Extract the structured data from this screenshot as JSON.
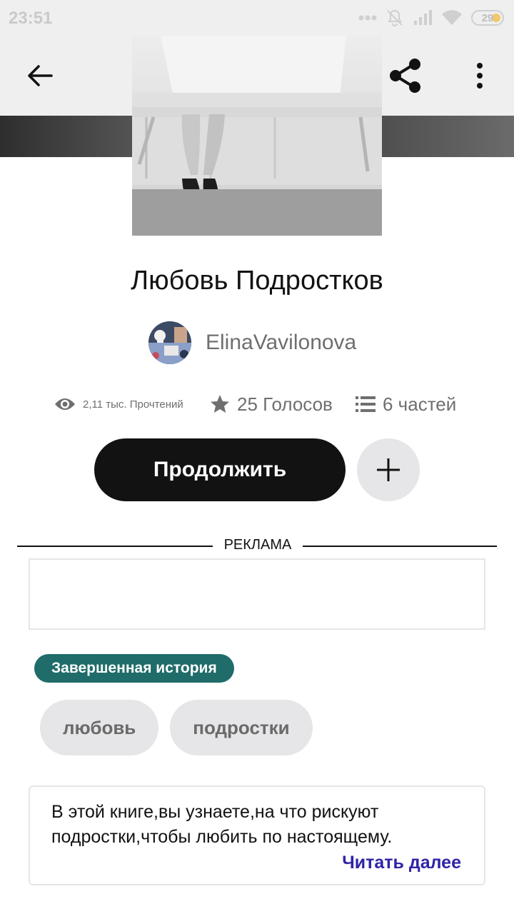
{
  "status_bar": {
    "time": "23:51",
    "battery": "29",
    "icons": [
      "dots-icon",
      "mute-icon",
      "signal-icon",
      "wifi-icon",
      "battery-icon"
    ]
  },
  "toolbar": {
    "back_icon": "arrow-left-icon",
    "share_icon": "share-icon",
    "more_icon": "more-vertical-icon"
  },
  "story": {
    "title": "Любовь Подростков",
    "author": "ElinaVavilonova",
    "stats": {
      "reads": "2,11 тыс. Прочтений",
      "votes": "25 Голосов",
      "parts": "6 частей"
    },
    "continue_label": "Продолжить",
    "status_badge": "Завершенная история",
    "tags": [
      "любовь",
      "подростки"
    ],
    "description": "В этой книге,вы узнаете,на что рискуют подростки,чтобы любить по настоящему.",
    "read_more": "Читать далее"
  },
  "ad": {
    "label": "РЕКЛАМА"
  },
  "colors": {
    "primary_button": "#121212",
    "badge": "#1f6c6a",
    "link": "#2f23a8",
    "chip": "#e6e5e7"
  }
}
